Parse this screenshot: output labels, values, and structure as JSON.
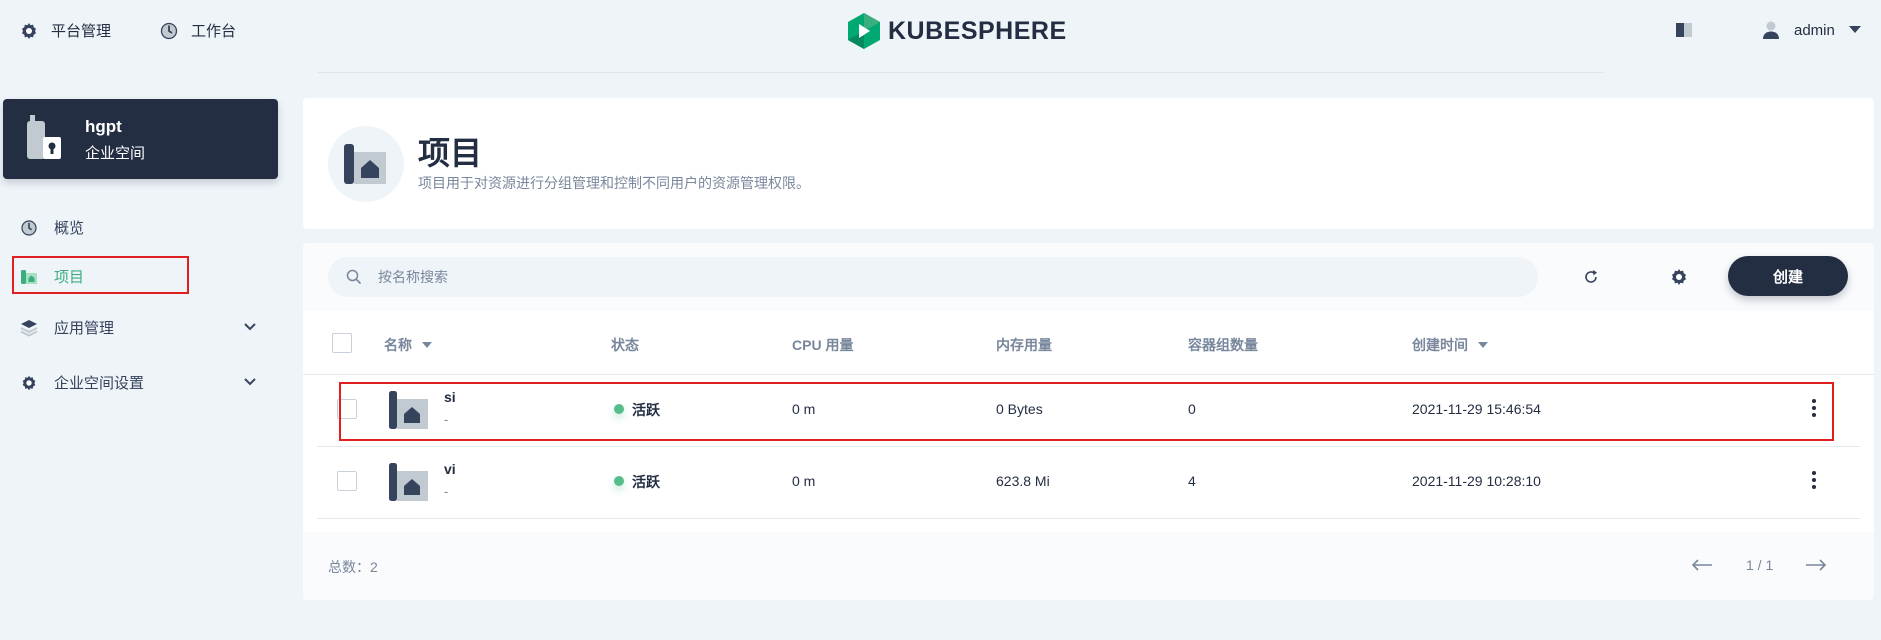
{
  "topnav": {
    "platform_label": "平台管理",
    "workbench_label": "工作台",
    "logo_text": "KUBESPHERE",
    "user_name": "admin"
  },
  "sidebar": {
    "workspace_name": "hgpt",
    "workspace_type": "企业空间",
    "items": [
      {
        "label": "概览",
        "icon": "dashboard-icon",
        "active": false
      },
      {
        "label": "项目",
        "icon": "project-icon",
        "active": true
      },
      {
        "label": "应用管理",
        "icon": "layers-icon",
        "active": false,
        "expandable": true
      },
      {
        "label": "企业空间设置",
        "icon": "gear-icon",
        "active": false,
        "expandable": true
      }
    ]
  },
  "header": {
    "title": "项目",
    "description": "项目用于对资源进行分组管理和控制不同用户的资源管理权限。"
  },
  "toolbar": {
    "search_placeholder": "按名称搜索",
    "create_label": "创建"
  },
  "table": {
    "columns": [
      "名称",
      "状态",
      "CPU 用量",
      "内存用量",
      "容器组数量",
      "创建时间"
    ],
    "rows": [
      {
        "name": "si",
        "alias": "-",
        "status": "活跃",
        "cpu": "0 m",
        "memory": "0 Bytes",
        "pods": "0",
        "created": "2021-11-29 15:46:54",
        "highlighted": true
      },
      {
        "name": "vi",
        "alias": "-",
        "status": "活跃",
        "cpu": "0 m",
        "memory": "623.8 Mi",
        "pods": "4",
        "created": "2021-11-29 10:28:10",
        "highlighted": false
      }
    ]
  },
  "footer": {
    "total_label": "总数：2",
    "pagination": "1 / 1"
  },
  "colors": {
    "brand": "#242e42",
    "accent": "#3bae80",
    "status_active": "#55bc8a",
    "highlight": "#e02020"
  }
}
